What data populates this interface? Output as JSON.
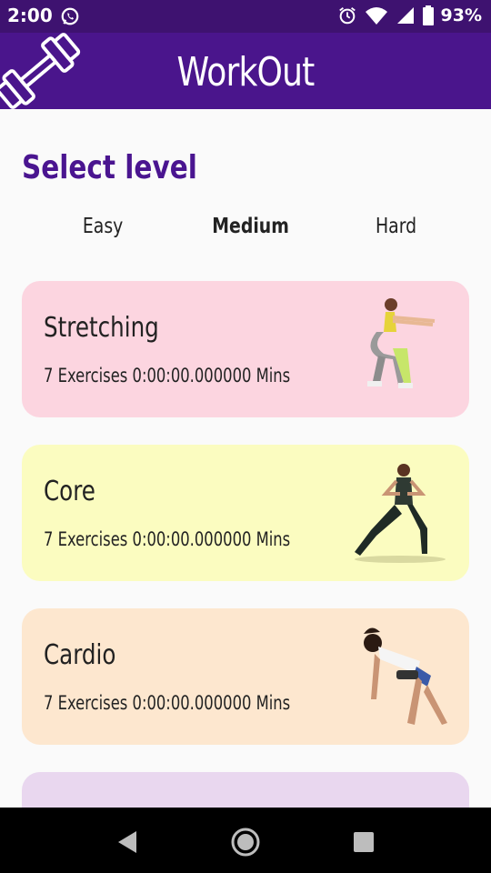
{
  "status_bar": {
    "time": "2:00",
    "battery_text": "93%",
    "icons": [
      "whatsapp-icon",
      "alarm-icon",
      "wifi-icon",
      "signal-icon",
      "battery-icon"
    ]
  },
  "app_bar": {
    "title": "WorkOut",
    "logo_icon": "dumbbell-icon",
    "color": "#4a158c"
  },
  "heading": "Select level",
  "levels": [
    {
      "label": "Easy",
      "active": false
    },
    {
      "label": "Medium",
      "active": true
    },
    {
      "label": "Hard",
      "active": false
    }
  ],
  "cards": [
    {
      "name": "Stretching",
      "info": "7 Exercises 0:00:00.000000 Mins",
      "color": "#fcd5e0"
    },
    {
      "name": "Core",
      "info": "7 Exercises 0:00:00.000000 Mins",
      "color": "#fbfcc0"
    },
    {
      "name": "Cardio",
      "info": "7 Exercises 0:00:00.000000 Mins",
      "color": "#fde7cf"
    },
    {
      "name": "",
      "info": "",
      "color": "#e9d7ef"
    }
  ],
  "nav_bar": {
    "icons": [
      "back-icon",
      "home-icon",
      "recents-icon"
    ]
  }
}
